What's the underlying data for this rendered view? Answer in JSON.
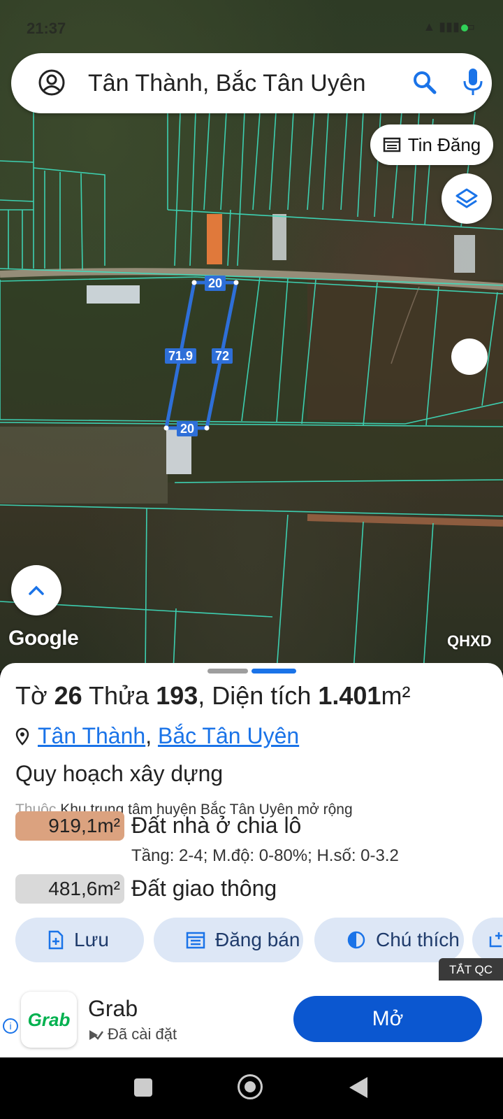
{
  "status_bar": {
    "time": "21:37"
  },
  "search": {
    "query": "Tân Thành, Bắc Tân Uyên"
  },
  "map": {
    "tin_dang_label": "Tin Đăng",
    "google_logo": "Google",
    "layer_label": "QHXD",
    "dimensions": {
      "top": "20",
      "left": "71.9",
      "right": "72",
      "bottom": "20"
    }
  },
  "parcel": {
    "title_prefix": "Tờ",
    "sheet_no": "26",
    "lot_label": "Thửa",
    "lot_no": "193",
    "area_label": ", Diện tích",
    "area_value": "1.401",
    "area_unit": "m²",
    "commune": "Tân Thành",
    "separator": ",",
    "district": "Bắc Tân Uyên",
    "plan_title": "Quy hoạch xây dựng",
    "belongs_prefix": "Thuộc",
    "belongs_text": "Khu trung tâm huyện Bắc Tân Uyên mở rộng",
    "zones": [
      {
        "area": "919,1m²",
        "name": "Đất nhà ở chia lô",
        "specs": "Tầng: 2-4; M.độ: 0-80%; H.số: 0-3.2",
        "color": "#dba27f"
      },
      {
        "area": "481,6m²",
        "name": "Đất giao thông",
        "color": "#d9d9d9"
      }
    ]
  },
  "actions": {
    "save": "Lưu",
    "sell": "Đăng bán",
    "legend": "Chú thích"
  },
  "ad": {
    "close_label": "TẮT QC",
    "app_name": "Grab",
    "status": "Đã cài đặt",
    "open_label": "Mở",
    "logo_text": "Grab"
  }
}
